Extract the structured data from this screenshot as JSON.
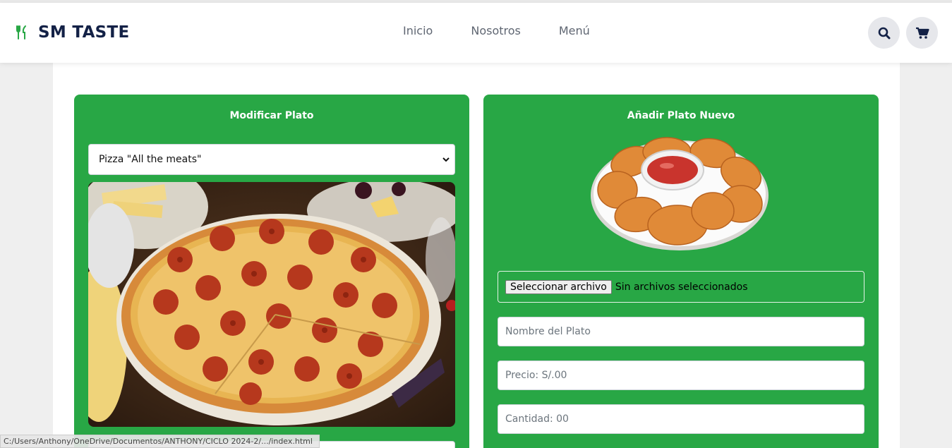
{
  "brand": {
    "name": "SM TASTE",
    "icon": "utensils-icon"
  },
  "nav": {
    "links": [
      "Inicio",
      "Nosotros",
      "Menú"
    ],
    "actions": [
      {
        "icon": "search-icon"
      },
      {
        "icon": "cart-icon"
      }
    ]
  },
  "modify_card": {
    "title": "Modificar Plato",
    "selected_dish": "Pizza \"All the meats\"",
    "image": "pizza-image"
  },
  "add_card": {
    "title": "Añadir Plato Nuevo",
    "image": "nuggets-image",
    "file_button": "Seleccionar archivo",
    "file_status": "Sin archivos seleccionados",
    "name_placeholder": "Nombre del Plato",
    "price_placeholder": "Precio: S/.00",
    "quantity_placeholder": "Cantidad: 00"
  },
  "statusbar": {
    "text": "C:/Users/Anthony/OneDrive/Documentos/ANTHONY/CICLO 2024-2/.../index.html"
  },
  "colors": {
    "accent": "#28a745",
    "brand_text": "#132146",
    "background": "#efefef"
  }
}
